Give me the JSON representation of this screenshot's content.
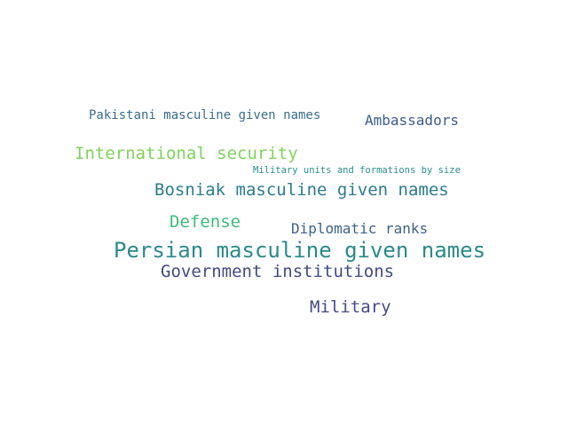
{
  "words": [
    {
      "text": "Pakistani masculine given names",
      "color": "#3b6d8d"
    },
    {
      "text": "Ambassadors",
      "color": "#3d5b8e"
    },
    {
      "text": "International security",
      "color": "#7fd35a"
    },
    {
      "text": "Military units and formations by size",
      "color": "#2a8d8d"
    },
    {
      "text": "Bosniak masculine given names",
      "color": "#2a7c8e"
    },
    {
      "text": "Defense",
      "color": "#3cbc78"
    },
    {
      "text": "Diplomatic ranks",
      "color": "#3d628c"
    },
    {
      "text": "Persian masculine given names",
      "color": "#2a8a8a"
    },
    {
      "text": "Government institutions",
      "color": "#424a86"
    },
    {
      "text": "Military",
      "color": "#474986"
    }
  ]
}
